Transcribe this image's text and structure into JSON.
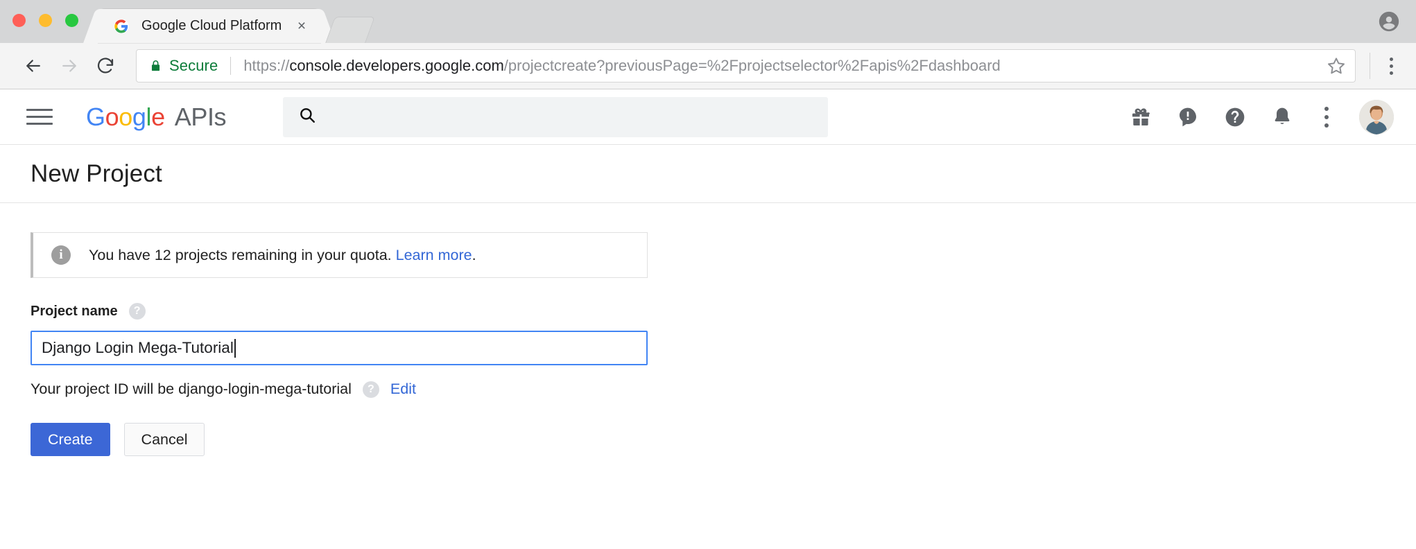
{
  "browser": {
    "tab": {
      "title": "Google Cloud Platform",
      "favicon_name": "google-g-favicon",
      "close_label": "×"
    },
    "toolbar": {
      "back_icon": "back-arrow-icon",
      "forward_icon": "forward-arrow-icon",
      "reload_icon": "reload-icon",
      "security_label": "Secure",
      "url_scheme": "https://",
      "url_host": "console.developers.google.com",
      "url_path": "/projectcreate?previousPage=%2Fprojectselector%2Fapis%2Fdashboard",
      "bookmark_icon": "star-icon",
      "menu_icon": "chrome-menu-icon"
    },
    "window_profile_icon": "profile-avatar-icon"
  },
  "header": {
    "menu_icon": "hamburger-menu-icon",
    "logo": {
      "letters": [
        "G",
        "o",
        "o",
        "g",
        "l",
        "e"
      ],
      "suffix": "APIs"
    },
    "search": {
      "icon": "search-icon",
      "value": "",
      "placeholder": ""
    },
    "actions": [
      {
        "name": "gift-icon",
        "label": "Offers"
      },
      {
        "name": "feedback-icon",
        "label": "Send feedback"
      },
      {
        "name": "help-icon",
        "label": "Help"
      },
      {
        "name": "notifications-bell-icon",
        "label": "Notifications"
      },
      {
        "name": "more-options-icon",
        "label": "More"
      },
      {
        "name": "account-avatar",
        "label": "Account"
      }
    ]
  },
  "page": {
    "title": "New Project",
    "banner": {
      "icon": "info-icon",
      "text": "You have 12 projects remaining in your quota.",
      "link_label": "Learn more",
      "trailing": "."
    },
    "form": {
      "project_name_label": "Project name",
      "project_name_help_icon": "help-circle-icon",
      "project_name_value": "Django Login Mega-Tutorial",
      "project_name_placeholder": "",
      "project_id_hint": "Your project ID will be django-login-mega-tutorial",
      "project_id_help_icon": "help-circle-icon",
      "edit_link_label": "Edit"
    },
    "buttons": {
      "create_label": "Create",
      "cancel_label": "Cancel"
    }
  },
  "colors": {
    "primary_button": "#3c67d6",
    "link": "#3367d6",
    "focus_border": "#4285f4",
    "secure_green": "#0d7c3a",
    "google_blue": "#4285f4",
    "google_red": "#ea4335",
    "google_yellow": "#fbbc05",
    "google_green": "#34a853"
  }
}
